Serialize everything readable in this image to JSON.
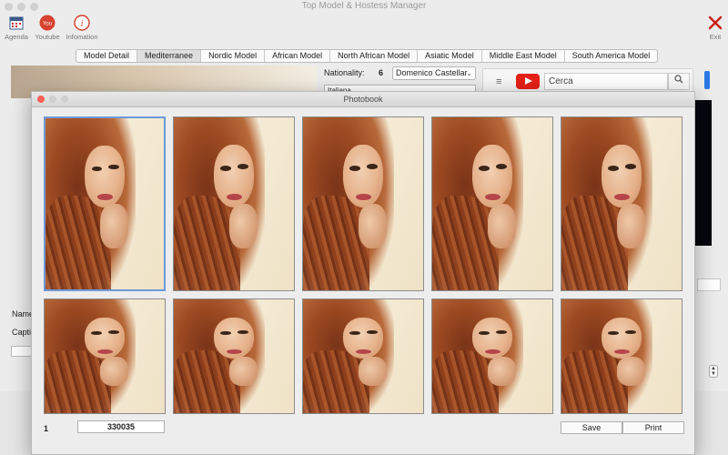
{
  "window": {
    "title": "Top Model & Hostess Manager"
  },
  "toolbar": {
    "items": [
      {
        "label": "Agenda",
        "icon": "calendar-icon"
      },
      {
        "label": "Youtube",
        "icon": "youtube-icon"
      },
      {
        "label": "Infomation",
        "icon": "info-icon"
      }
    ],
    "exit_label": "Exit"
  },
  "tabs": [
    "Model Detail",
    "Mediterranee",
    "Nordic Model",
    "African Model",
    "North African Model",
    "Asiatic Model",
    "Middle East Model",
    "South America Model"
  ],
  "active_tab": "Mediterranee",
  "detail": {
    "nationality_label": "Nationality:",
    "nationality_num": "6",
    "agent_select": "Domenico Castellar",
    "sub_select": "Italiana",
    "name_label": "Name",
    "caption_label": "Capti"
  },
  "youtube": {
    "search_placeholder": "Cerca",
    "search_icon": "magnifier-icon",
    "menu_icon": "hamburger-icon"
  },
  "dialog": {
    "title": "Photobook",
    "page_number": "1",
    "code": "330035",
    "save_label": "Save",
    "print_label": "Print",
    "photo_count": 10,
    "selected_photo": 1
  },
  "colors": {
    "accent": "#6e9ad8",
    "youtube_red": "#e62117",
    "close_dot": "#fc5f57"
  }
}
